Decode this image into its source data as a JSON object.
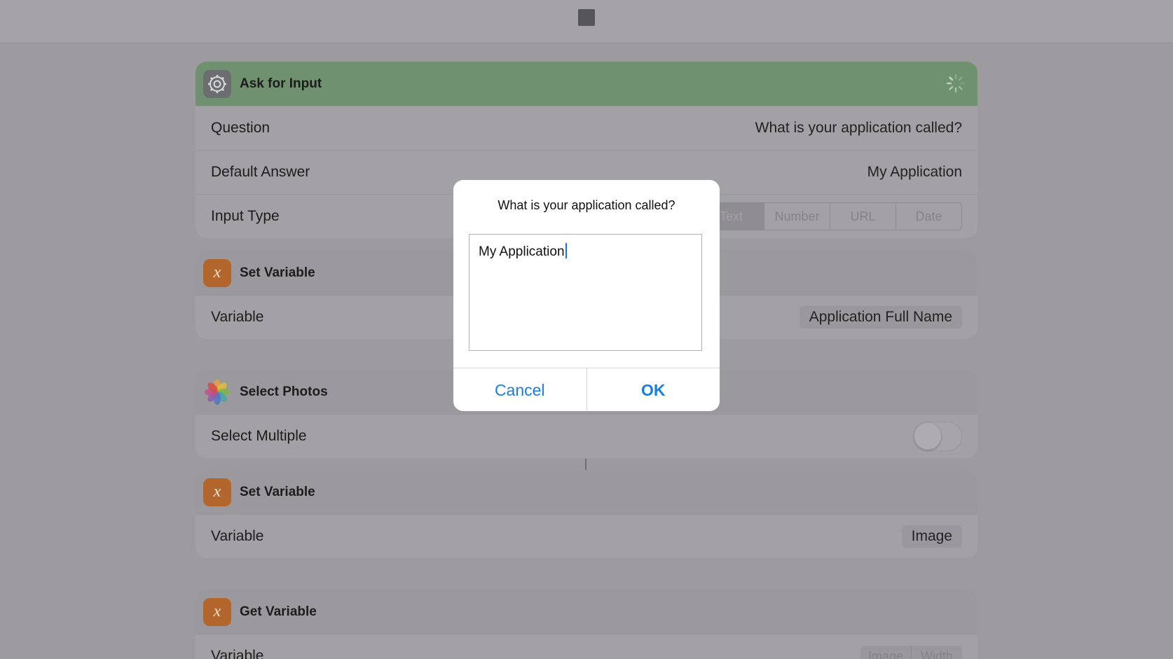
{
  "ask_input": {
    "title": "Ask for Input",
    "question_label": "Question",
    "question_value": "What is your application called?",
    "default_label": "Default Answer",
    "default_value": "My Application",
    "input_type_label": "Input Type",
    "input_types": [
      "Text",
      "Number",
      "URL",
      "Date"
    ],
    "selected_input_type": "Text"
  },
  "set_variable_1": {
    "title": "Set Variable",
    "variable_label": "Variable",
    "variable_value": "Application Full Name"
  },
  "select_photos": {
    "title": "Select Photos",
    "select_multiple_label": "Select Multiple",
    "select_multiple_on": false
  },
  "set_variable_2": {
    "title": "Set Variable",
    "variable_label": "Variable",
    "variable_value": "Image"
  },
  "get_variable": {
    "title": "Get Variable",
    "variable_label": "Variable",
    "tokens": [
      "Image",
      "Width"
    ]
  },
  "dialog": {
    "title": "What is your application called?",
    "input_value": "My Application",
    "cancel_label": "Cancel",
    "ok_label": "OK"
  },
  "colors": {
    "accent": "#1a7ee0",
    "header_green": "#6f9170",
    "variable_icon": "#b2662b"
  },
  "icons": {
    "stop": "stop-icon",
    "settings": "gear-icon",
    "variable": "variable-icon",
    "photos": "photos-icon",
    "loading": "spinner-icon"
  }
}
